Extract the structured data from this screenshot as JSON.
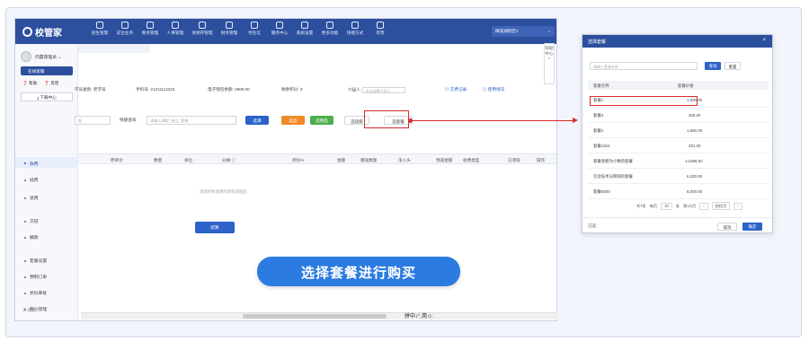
{
  "app": {
    "logo_text": "校管家",
    "nav_items": [
      "招生管理",
      "前台业务",
      "教务管理",
      "人事管理",
      "进销存管理",
      "财务管理",
      "师生信",
      "服务中心",
      "系统设置",
      "更多功能",
      "快捷方式",
      "有赞"
    ],
    "campus_label": "梅溪湖校区2",
    "campus_chevron": "⌄"
  },
  "sidebar": {
    "user_name": "内置管理员 ⌄",
    "online_btn": "在线客服",
    "help": "帮助",
    "feedback": "反馈",
    "download_center": "下载中心",
    "menu": [
      "收费",
      "续费",
      "退费",
      "交班",
      "撤款",
      "套餐设置",
      "预制订单",
      "折扣审批",
      "积分管理"
    ],
    "active_menu_index": 0,
    "bottom": "收起"
  },
  "student_info": {
    "student_category": "学员类别: 老学员",
    "phone": "手机号: 21211112222",
    "balance": "电子钱包余额: 2800.00",
    "points": "剩余积分: 3",
    "introducer_label": "介绍人:",
    "introducer_placeholder": "点击选择介绍人",
    "payment_record": "交费记录",
    "usage_status": "使用情况"
  },
  "toolbar": {
    "left_input_placeholder": "报",
    "quick_search_label": "快捷查询:",
    "quick_search_placeholder": "请输入课程, 物品, 套餐",
    "select_btn": "选课",
    "item_btn": "选品",
    "deposit_btn": "选物品",
    "select_class_btn": "选班级",
    "select_package_btn": "选套餐",
    "colors": {
      "blue": "#2c62c9",
      "orange": "#f08a24",
      "green": "#4cae4c"
    }
  },
  "table": {
    "columns": [
      "原单价",
      "数量",
      "单位",
      "分摊 ⓘ",
      "折扣%",
      "金额",
      "赠送数量",
      "净入头",
      "预减金额",
      "收费类型",
      "已领取",
      "操作"
    ],
    "empty_text": "请选择要收费的课程或物品",
    "settle_btn": "结算"
  },
  "help_center": "帮助中心 «",
  "ime_text": "拼中♪°,简☺:",
  "cta_text": "选择套餐进行购买",
  "dialog": {
    "title": "选择套餐",
    "close": "×",
    "search_placeholder": "请输入套餐名称",
    "query_btn": "查询",
    "reset_btn": "重置",
    "headers": [
      "套餐名称",
      "套餐价格"
    ],
    "rows": [
      {
        "name": "套餐1",
        "price": "1,000.00"
      },
      {
        "name": "套餐3",
        "price": "400.00"
      },
      {
        "name": "套餐2",
        "price": "1,600.00"
      },
      {
        "name": "套餐1104",
        "price": "301.00"
      },
      {
        "name": "套餐金额为小数的套餐",
        "price": "14,696.50"
      },
      {
        "name": "包含技术分期保的套餐",
        "price": "6,330.00"
      },
      {
        "name": "套餐5000",
        "price": "8,000.00"
      }
    ],
    "pager": {
      "total": "共7条",
      "per_page_label": "每页",
      "per_page": "10",
      "per_page_unit": "条",
      "page_info": "第1/1页",
      "prev": "‹",
      "page_input": "前往页",
      "next": "›"
    },
    "footer_left": "已选:",
    "cancel_btn": "取消",
    "confirm_btn": "确定"
  }
}
